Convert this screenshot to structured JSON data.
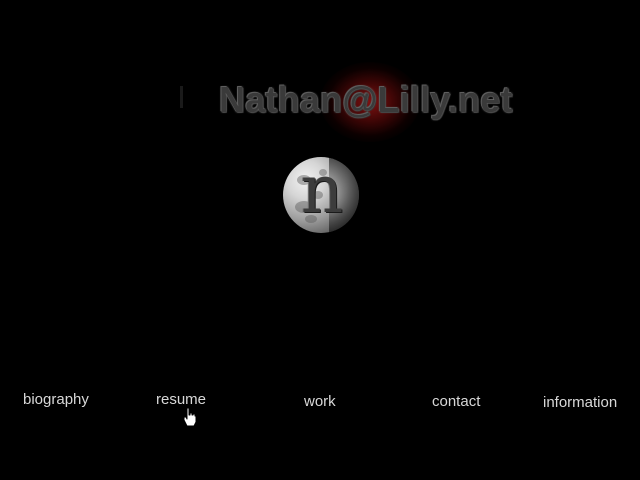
{
  "site": {
    "title": "Nathan@Lilly.net",
    "logo_letter": "n",
    "accent_glow_color": "#8a1010"
  },
  "nav": {
    "items": [
      {
        "label": "biography"
      },
      {
        "label": "resume"
      },
      {
        "label": "work"
      },
      {
        "label": "contact"
      },
      {
        "label": "information"
      }
    ],
    "hovered": "resume"
  },
  "icons": {
    "logo": "moon-icon",
    "pointer": "hand-pointer-icon"
  },
  "colors": {
    "background": "#000000",
    "nav_text": "#d8d8d8",
    "title_text": "#3a3a3a"
  }
}
